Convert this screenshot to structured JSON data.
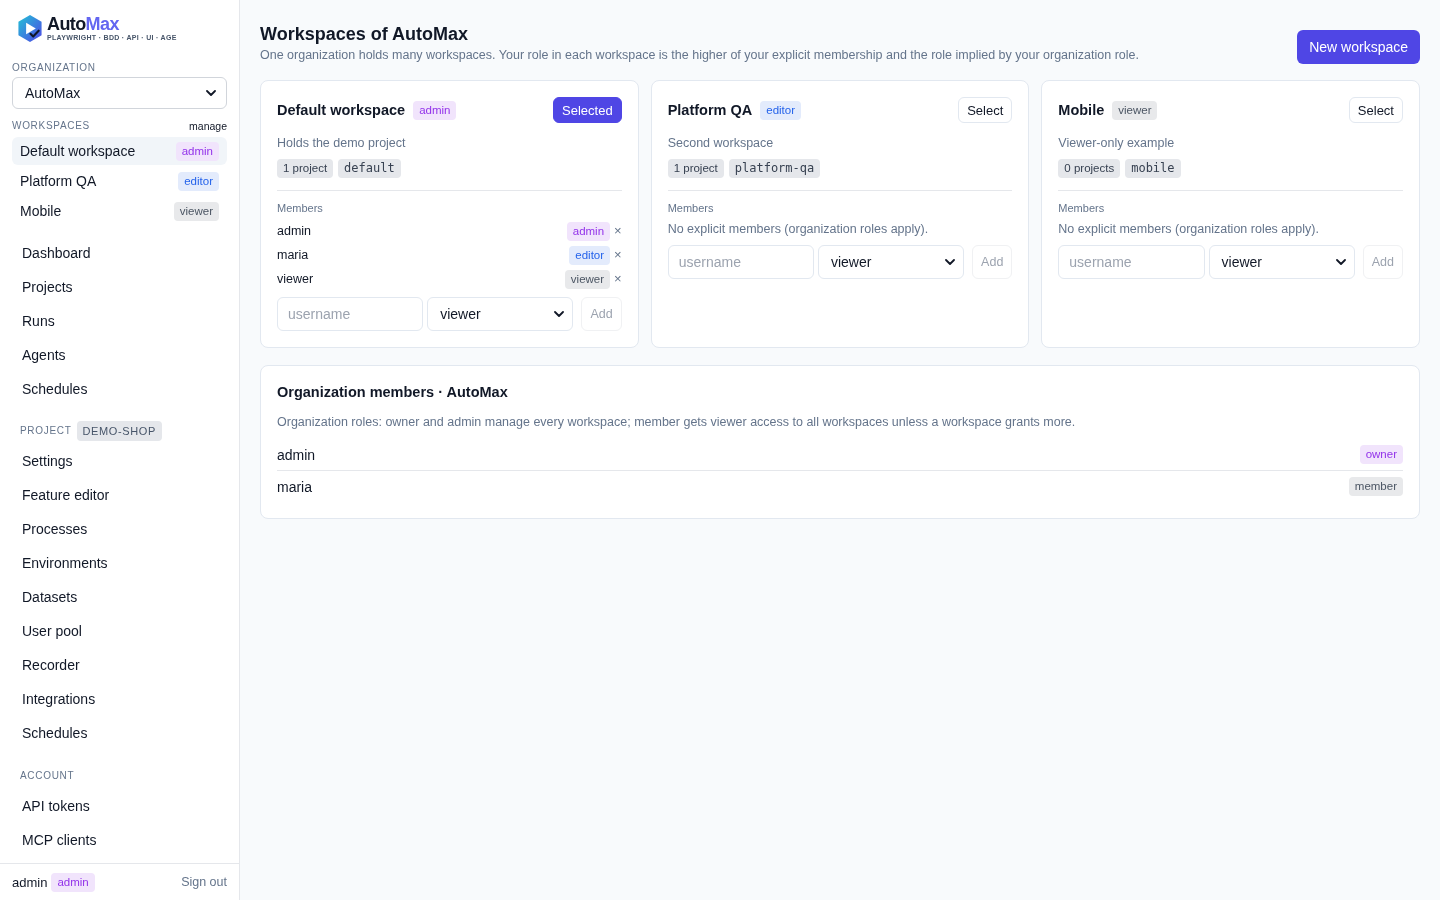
{
  "sidebar": {
    "logo": {
      "wordmark": "Auto",
      "wordmark_accent": "Max",
      "tagline": "PLAYWRIGHT · BDD · API · UI · AGE"
    },
    "organization": {
      "label": "ORGANIZATION",
      "value": "AutoMax"
    },
    "workspaces": {
      "label": "WORKSPACES",
      "manage": "manage",
      "items": [
        {
          "name": "Default workspace",
          "role": {
            "label": "admin",
            "color": "#9333ea"
          },
          "selected": true
        },
        {
          "name": "Platform QA",
          "role": {
            "label": "editor",
            "color": "#2563eb"
          },
          "selected": false
        },
        {
          "name": "Mobile",
          "role": {
            "label": "viewer",
            "color": "#4b5563"
          },
          "selected": false
        }
      ]
    },
    "nav_groups": [
      {
        "items": [
          {
            "label": "Dashboard",
            "selected": false
          },
          {
            "label": "Projects",
            "selected": false
          },
          {
            "label": "Runs",
            "selected": false
          },
          {
            "label": "Agents",
            "selected": false
          },
          {
            "label": "Schedules",
            "selected": false
          }
        ]
      },
      {
        "label": "PROJECT",
        "badge": "DEMO-SHOP",
        "items": [
          {
            "label": "Settings",
            "selected": false
          },
          {
            "label": "Feature editor",
            "selected": false
          },
          {
            "label": "Processes",
            "selected": false
          },
          {
            "label": "Environments",
            "selected": false
          },
          {
            "label": "Datasets",
            "selected": false
          },
          {
            "label": "User pool",
            "selected": false
          },
          {
            "label": "Recorder",
            "selected": false
          },
          {
            "label": "Integrations",
            "selected": false
          },
          {
            "label": "Schedules",
            "selected": false
          }
        ]
      },
      {
        "label": "ACCOUNT",
        "items": [
          {
            "label": "API tokens",
            "selected": false
          },
          {
            "label": "MCP clients",
            "selected": false
          }
        ]
      }
    ],
    "footer": {
      "user": "admin",
      "role": {
        "label": "admin",
        "color": "#9333ea"
      },
      "sign_out": "Sign out"
    }
  },
  "header": {
    "title": "Workspaces of AutoMax",
    "subtitle": "One organization holds many workspaces. Your role in each workspace is the higher of your explicit membership and the role implied by your organization role.",
    "new_button": "New workspace"
  },
  "workspace_cards": [
    {
      "name": "Default workspace",
      "role": {
        "label": "admin",
        "color": "#9333ea"
      },
      "selected": true,
      "select_label": "Selected",
      "description": "Holds the demo project",
      "project_count": "1 project",
      "slug": "default",
      "members_label": "Members",
      "members": [
        {
          "username": "admin",
          "role": {
            "label": "admin",
            "color": "#9333ea"
          },
          "remove": "×"
        },
        {
          "username": "maria",
          "role": {
            "label": "editor",
            "color": "#2563eb"
          },
          "remove": "×"
        },
        {
          "username": "viewer",
          "role": {
            "label": "viewer",
            "color": "#4b5563"
          },
          "remove": "×"
        }
      ],
      "add_form": {
        "placeholder": "username",
        "role_value": "viewer",
        "add_label": "Add",
        "disabled": true
      }
    },
    {
      "name": "Platform QA",
      "role": {
        "label": "editor",
        "color": "#2563eb"
      },
      "selected": false,
      "select_label": "Select",
      "description": "Second workspace",
      "project_count": "1 project",
      "slug": "platform-qa",
      "members_label": "Members",
      "empty_note": "No explicit members (organization roles apply).",
      "add_form": {
        "placeholder": "username",
        "role_value": "viewer",
        "add_label": "Add",
        "disabled": true
      }
    },
    {
      "name": "Mobile",
      "role": {
        "label": "viewer",
        "color": "#4b5563"
      },
      "selected": false,
      "select_label": "Select",
      "description": "Viewer-only example",
      "project_count": "0 projects",
      "slug": "mobile",
      "members_label": "Members",
      "empty_note": "No explicit members (organization roles apply).",
      "add_form": {
        "placeholder": "username",
        "role_value": "viewer",
        "add_label": "Add",
        "disabled": true
      }
    }
  ],
  "org_members": {
    "title": "Organization members · AutoMax",
    "description": "Organization roles: owner and admin manage every workspace; member gets viewer access to all workspaces unless a workspace grants more.",
    "members": [
      {
        "username": "admin",
        "role": {
          "label": "owner",
          "color": "#9333ea"
        }
      },
      {
        "username": "maria",
        "role": {
          "label": "member",
          "color": "#4b5563"
        }
      }
    ]
  }
}
